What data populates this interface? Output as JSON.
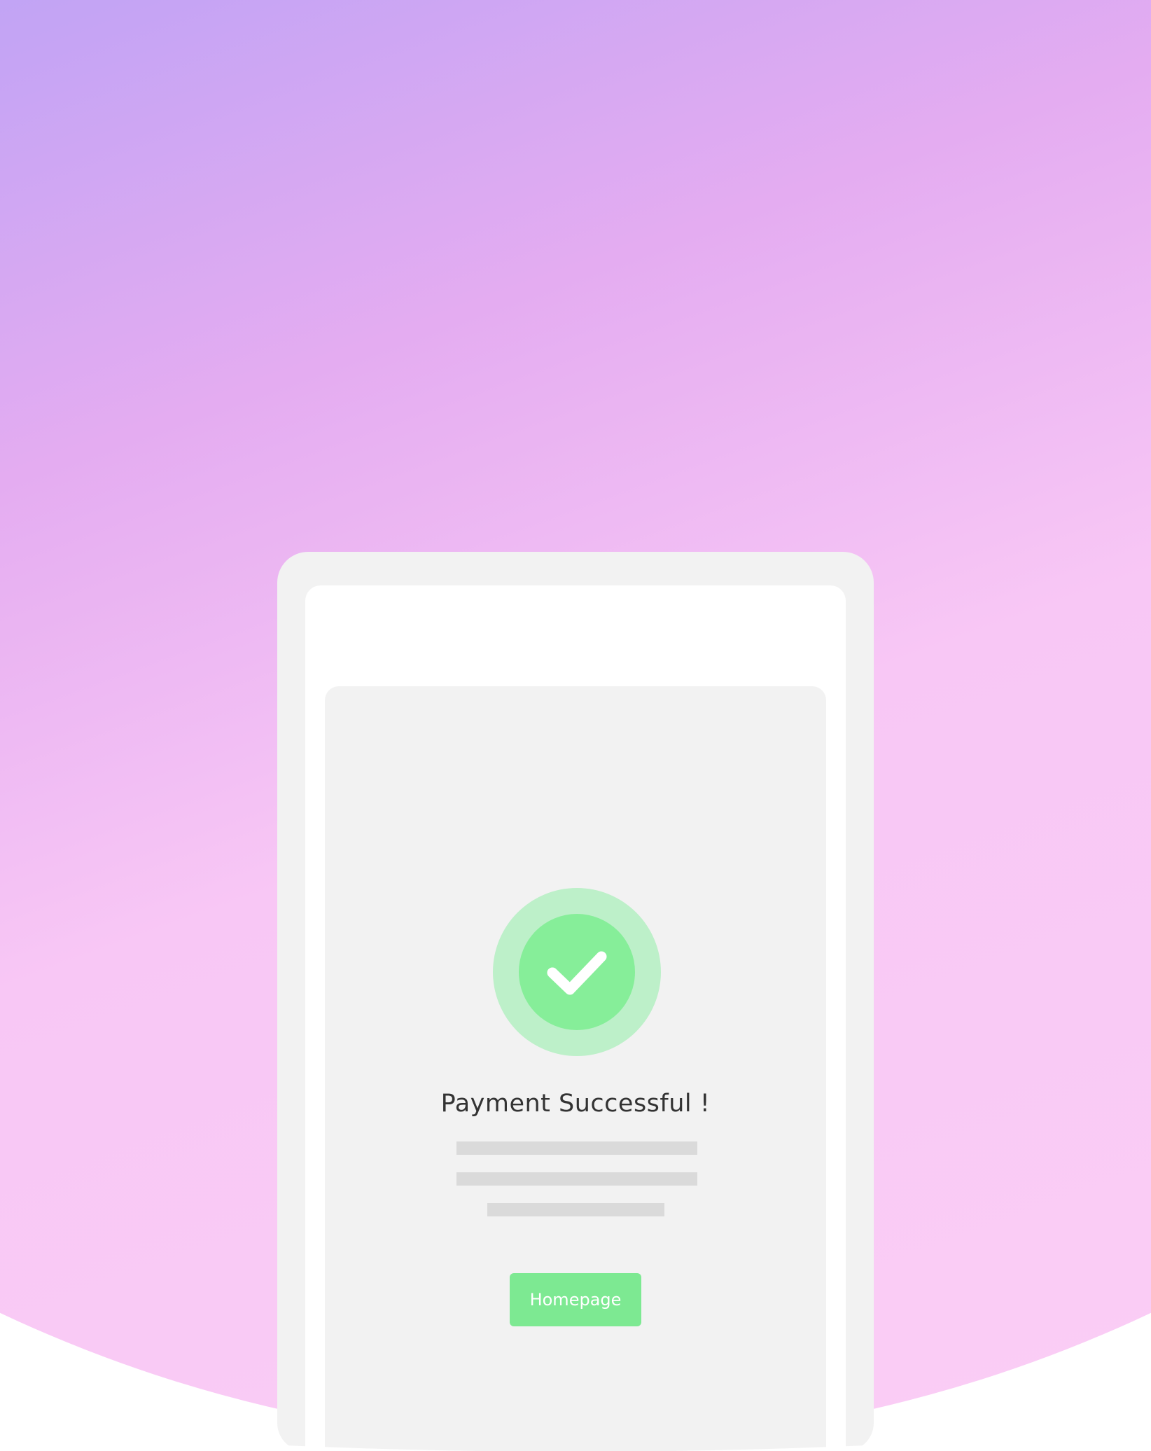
{
  "payment": {
    "title": "Payment Successful !",
    "button_label": "Homepage"
  },
  "icons": {
    "status": "check-circle-icon"
  },
  "colors": {
    "gradient_top": "#9aa9ff",
    "gradient_bottom": "#fbd0f5",
    "success_outer": "#bdf0c9",
    "success_inner": "#86ee99",
    "button": "#7de992",
    "frame": "#f2f2f2",
    "placeholder_line": "#dadada"
  }
}
